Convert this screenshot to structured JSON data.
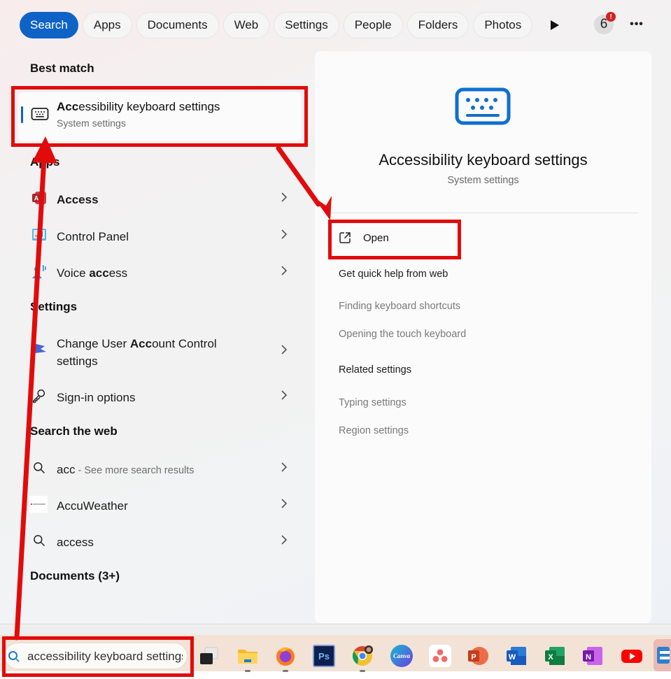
{
  "filters": {
    "tabs": [
      {
        "label": "Search",
        "active": true
      },
      {
        "label": "Apps",
        "active": false
      },
      {
        "label": "Documents",
        "active": false
      },
      {
        "label": "Web",
        "active": false
      },
      {
        "label": "Settings",
        "active": false
      },
      {
        "label": "People",
        "active": false
      },
      {
        "label": "Folders",
        "active": false
      },
      {
        "label": "Photos",
        "active": false
      }
    ],
    "more_tabs_icon": "play-icon",
    "rewards_count": "6",
    "rewards_alert": "!",
    "more_options_label": "•••"
  },
  "results": {
    "best_match_header": "Best match",
    "best_match": {
      "title_bold": "Acc",
      "title_rest": "essibility keyboard settings",
      "subtitle": "System settings",
      "icon": "keyboard-icon"
    },
    "apps_header": "Apps",
    "apps": [
      {
        "bold": "Access",
        "rest": "",
        "icon": "ms-access-icon"
      },
      {
        "pre": "Control Panel",
        "icon": "control-panel-icon"
      },
      {
        "pre": "Voice ",
        "bold": "acc",
        "rest": "ess",
        "icon": "voice-access-icon"
      }
    ],
    "settings_header": "Settings",
    "settings": [
      {
        "pre": "Change User ",
        "bold": "Acc",
        "rest": "ount Control",
        "line2": "settings",
        "icon": "uac-flag-icon"
      },
      {
        "pre": "Sign-in options",
        "icon": "key-icon"
      }
    ],
    "web_header": "Search the web",
    "web": [
      {
        "bold": "acc",
        "muted": " - See more search results",
        "icon": "search-icon"
      },
      {
        "bold": "AccuWeather",
        "icon": "accuweather-icon"
      },
      {
        "bold": "access",
        "icon": "search-icon"
      }
    ],
    "documents_header": "Documents (3+)"
  },
  "preview": {
    "icon": "keyboard-icon",
    "title": "Accessibility keyboard settings",
    "subtitle": "System settings",
    "open_label": "Open",
    "quick_help_header": "Get quick help from web",
    "quick_help_links": [
      "Finding keyboard shortcuts",
      "Opening the touch keyboard"
    ],
    "related_header": "Related settings",
    "related_links": [
      "Typing settings",
      "Region settings"
    ]
  },
  "taskbar": {
    "search_value": "accessibility keyboard settings",
    "apps": [
      {
        "name": "task-view",
        "label": ""
      },
      {
        "name": "file-explorer",
        "label": ""
      },
      {
        "name": "firefox",
        "label": ""
      },
      {
        "name": "photoshop",
        "label": "Ps"
      },
      {
        "name": "chrome",
        "label": ""
      },
      {
        "name": "canva",
        "label": "Canva"
      },
      {
        "name": "asana",
        "label": ""
      },
      {
        "name": "powerpoint",
        "label": "P"
      },
      {
        "name": "word",
        "label": "W"
      },
      {
        "name": "excel",
        "label": "X"
      },
      {
        "name": "onenote",
        "label": "N"
      },
      {
        "name": "youtube",
        "label": ""
      },
      {
        "name": "app-partial",
        "label": ""
      }
    ]
  },
  "colors": {
    "accent": "#0f63c6",
    "annotation": "#e20b0b"
  }
}
